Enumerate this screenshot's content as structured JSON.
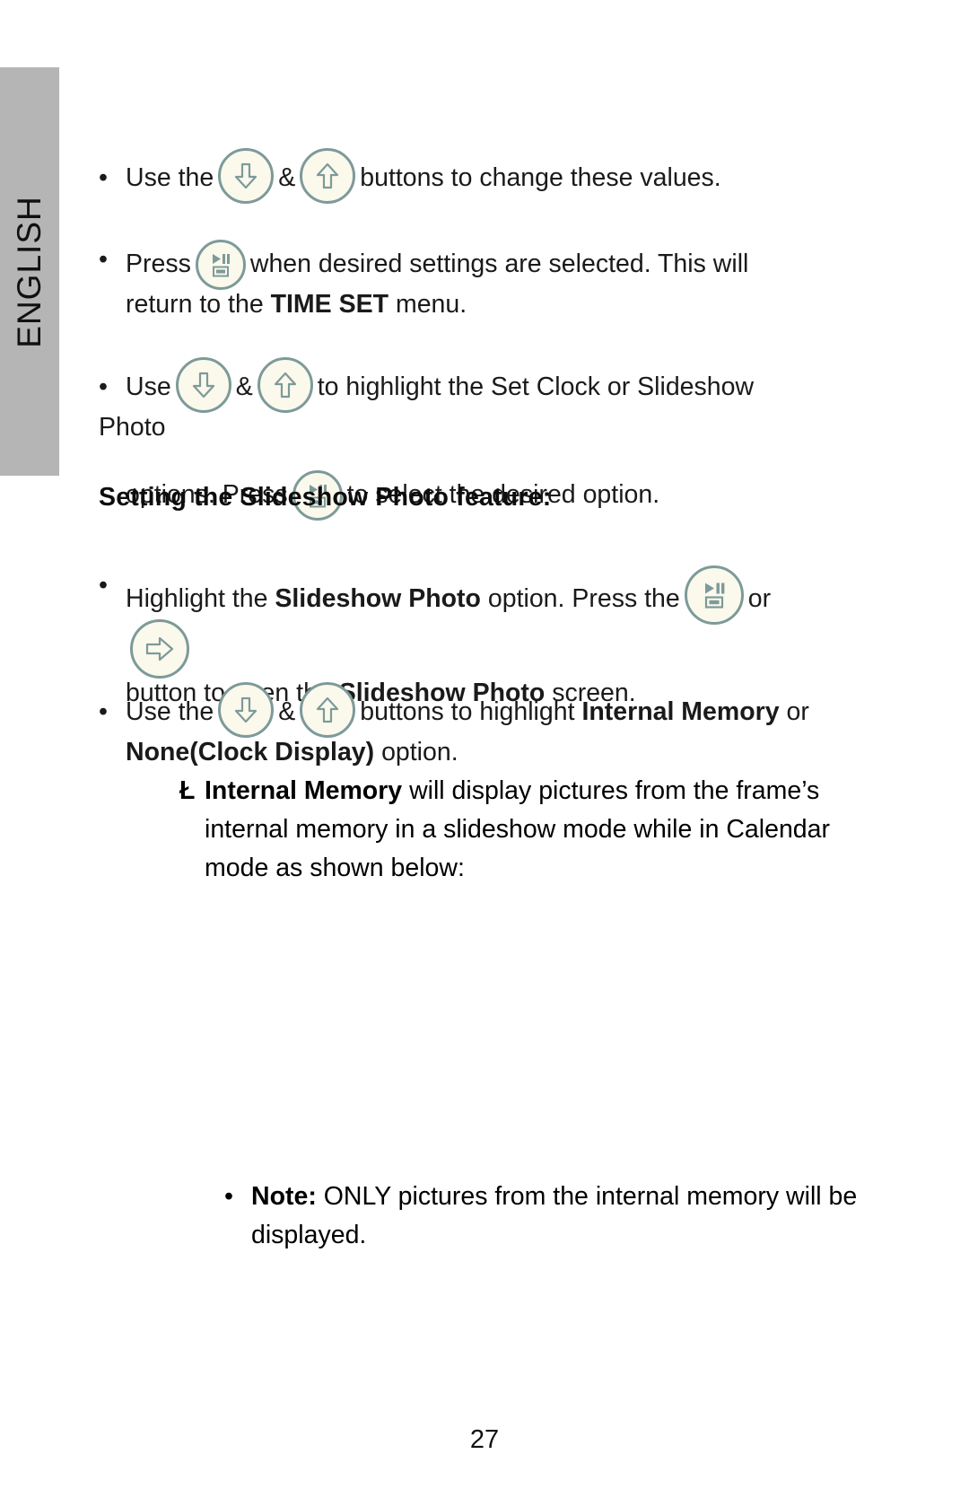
{
  "document": {
    "page_number": "27",
    "language_tab": "ENGLISH"
  },
  "colors": {
    "tab_background": "#b5b5b5",
    "button_border": "#7d9a99",
    "button_fill": "#faf9ec",
    "text": "#000000"
  },
  "icons": {
    "down_arrow": "down-arrow-icon",
    "up_arrow": "up-arrow-icon",
    "play_pause_screen": "play-pause-screen-icon",
    "right_arrow": "right-arrow-icon"
  },
  "content": {
    "bullet1": {
      "marker": "•",
      "part1": "Use the",
      "amp": "&",
      "part2": "buttons to change these values."
    },
    "bullet2": {
      "marker": "•",
      "part1": "Press",
      "part2": "when desired settings are selected. This will return to the",
      "bold1": "TIME SET",
      "part3": "menu."
    },
    "bullet3": {
      "marker": "•",
      "part1": "Use",
      "amp": "&",
      "part2": "to highlight the Set Clock or Slideshow Photo",
      "part3": "options.  Press",
      "part4": "to select the desired option."
    },
    "heading": "Setting the Slideshow Photo feature:",
    "bullet4": {
      "marker": "•",
      "part1": "Highlight the",
      "bold1": "Slideshow Photo",
      "part2": "option. Press the",
      "or": "or",
      "part3": "button to open the",
      "bold2": "Slideshow Photo",
      "part4": "screen."
    },
    "bullet5": {
      "marker": "•",
      "part1": "Use the",
      "amp": "&",
      "part2": "buttons to highlight",
      "bold1": "Internal Memory",
      "part3": "or",
      "bold2": "None(Clock Display)",
      "part4": "option."
    },
    "subbullet": {
      "marker": "Ł",
      "bold1": "Internal Memory",
      "text": "will display pictures from the frame’s internal memory in a slideshow mode while in Calendar mode as shown below:"
    },
    "note": {
      "marker": "•",
      "bold1": "Note:",
      "text": "ONLY pictures from the internal memory will be displayed."
    }
  }
}
